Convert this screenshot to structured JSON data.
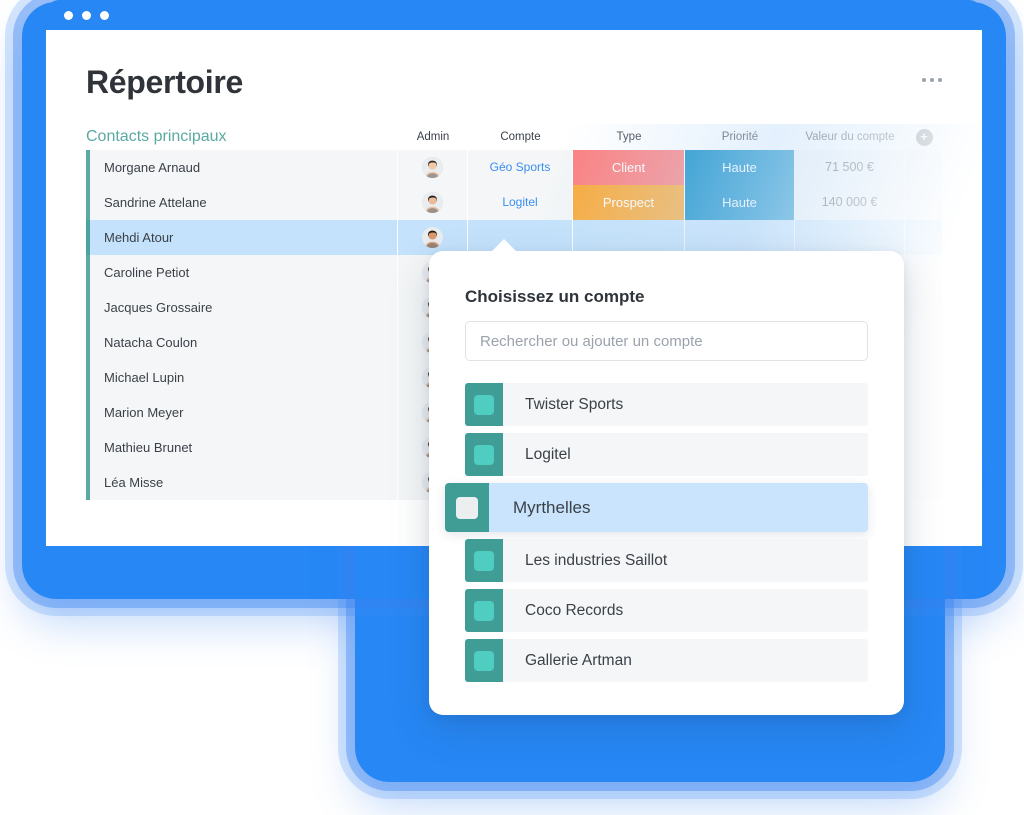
{
  "window": {
    "dots": [
      "close-dot",
      "minimize-dot",
      "maximize-dot"
    ],
    "title": "Répertoire",
    "kebab_label": "•••"
  },
  "table": {
    "group_label": "Contacts principaux",
    "headers": {
      "name": "",
      "admin": "Admin",
      "compte": "Compte",
      "type": "Type",
      "priorite": "Priorité",
      "valeur": "Valeur du compte",
      "add": "+"
    },
    "rows": [
      {
        "name": "Morgane Arnaud",
        "compte": "Géo Sports",
        "type": "Client",
        "priorite": "Haute",
        "valeur": "71 500 €",
        "selected": false
      },
      {
        "name": "Sandrine Attelane",
        "compte": "Logitel",
        "type": "Prospect",
        "priorite": "Haute",
        "valeur": "140 000 €",
        "selected": false
      },
      {
        "name": "Mehdi Atour",
        "compte": "",
        "type": "",
        "priorite": "",
        "valeur": "",
        "selected": true
      },
      {
        "name": "Caroline Petiot",
        "compte": "",
        "type": "",
        "priorite": "",
        "valeur": "",
        "selected": false
      },
      {
        "name": "Jacques Grossaire",
        "compte": "",
        "type": "",
        "priorite": "",
        "valeur": "",
        "selected": false
      },
      {
        "name": "Natacha Coulon",
        "compte": "",
        "type": "",
        "priorite": "",
        "valeur": "",
        "selected": false
      },
      {
        "name": "Michael Lupin",
        "compte": "",
        "type": "",
        "priorite": "",
        "valeur": "",
        "selected": false
      },
      {
        "name": "Marion Meyer",
        "compte": "",
        "type": "",
        "priorite": "",
        "valeur": "",
        "selected": false
      },
      {
        "name": "Mathieu Brunet",
        "compte": "",
        "type": "",
        "priorite": "",
        "valeur": "",
        "selected": false
      },
      {
        "name": "Léa Misse",
        "compte": "",
        "type": "",
        "priorite": "",
        "valeur": "",
        "selected": false
      }
    ]
  },
  "dropdown": {
    "title": "Choisissez un compte",
    "search_placeholder": "Rechercher ou ajouter un compte",
    "search_value": "",
    "items": [
      {
        "label": "Twister Sports",
        "active": false
      },
      {
        "label": "Logitel",
        "active": false
      },
      {
        "label": "Myrthelles",
        "active": true
      },
      {
        "label": "Les industries Saillot",
        "active": false
      },
      {
        "label": "Coco Records",
        "active": false
      },
      {
        "label": "Gallerie Artman",
        "active": false
      }
    ]
  },
  "colors": {
    "brand_blue": "#2687f5",
    "teal_accent": "#5aa9a2",
    "status_client": "#fc7f7f",
    "status_prospect": "#f9a938",
    "status_haute": "#0287c3",
    "link_blue": "#3a8ef0",
    "swatch_outer": "#3f9d95",
    "swatch_inner": "#4ecdc0",
    "row_bg": "#f4f6f7",
    "row_selected": "#c4e2fb"
  }
}
